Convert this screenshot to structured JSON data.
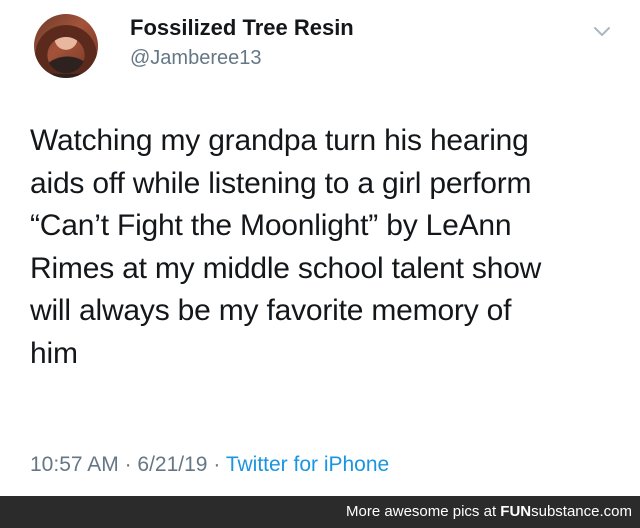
{
  "tweet": {
    "author": {
      "display_name": "Fossilized Tree Resin",
      "handle": "@Jamberee13"
    },
    "text_lines": [
      "Watching my grandpa turn his hearing",
      "aids off while listening to a girl perform",
      "“Can’t Fight the Moonlight” by LeAnn",
      "Rimes at my middle school talent show",
      "will always be my favorite memory of",
      "him"
    ],
    "meta": {
      "time": "10:57 AM",
      "date": "6/21/19",
      "separator": "·",
      "source": "Twitter for iPhone"
    }
  },
  "footer": {
    "prefix": "More awesome pics at ",
    "brand_bold": "FUN",
    "brand_rest": "substance.com"
  },
  "colors": {
    "text": "#14171a",
    "secondary": "#657786",
    "link": "#1b95e0",
    "footer_bg": "#2b2b2b"
  },
  "icons": {
    "menu": "chevron-down-icon"
  }
}
